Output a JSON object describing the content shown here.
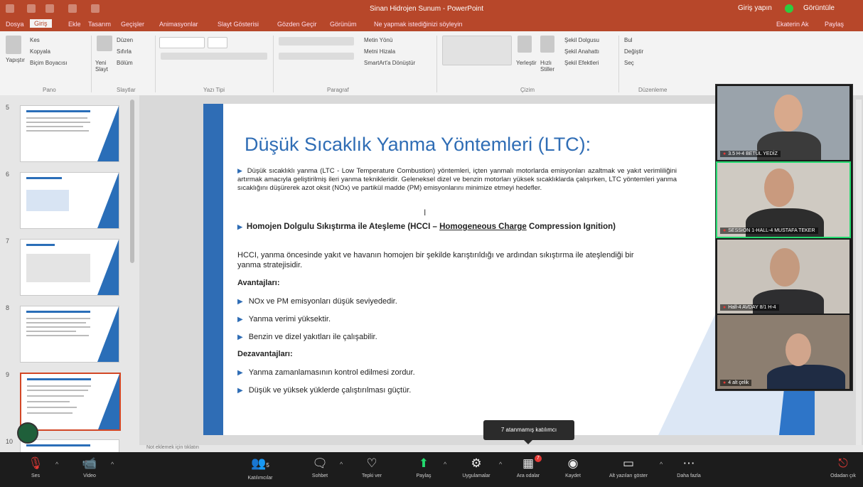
{
  "window": {
    "title": "Sinan Hidrojen Sunum - PowerPoint",
    "signin": "Giriş yapın",
    "display": "Görüntüle"
  },
  "ribbon_tabs": [
    "Dosya",
    "Giriş",
    "Ekle",
    "Tasarım",
    "Geçişler",
    "Animasyonlar",
    "Slayt Gösterisi",
    "Gözden Geçir",
    "Görünüm"
  ],
  "ribbon_search": "Ne yapmak istediğinizi söyleyin",
  "ribbon_right": {
    "share_user": "Ekaterin Ak",
    "share": "Paylaş"
  },
  "ribbon": {
    "clipboard": {
      "paste": "Yapıştır",
      "cut": "Kes",
      "copy": "Kopyala",
      "format": "Biçim Boyacısı",
      "label": "Pano"
    },
    "slides": {
      "new": "Yeni Slayt",
      "layout": "Düzen",
      "reset": "Sıfırla",
      "section": "Bölüm",
      "label": "Slaytlar"
    },
    "font": {
      "label": "Yazı Tipi"
    },
    "paragraph": {
      "direction": "Metin Yönü",
      "align": "Metni Hizala",
      "smartart": "SmartArt'a Dönüştür",
      "label": "Paragraf"
    },
    "drawing": {
      "arrange": "Yerleştir",
      "quick": "Hızlı Stiller",
      "fill": "Şekil Dolgusu",
      "outline": "Şekil Anahattı",
      "effects": "Şekil Efektleri",
      "label": "Çizim"
    },
    "editing": {
      "find": "Bul",
      "replace": "Değiştir",
      "select": "Seç",
      "label": "Düzenleme"
    }
  },
  "thumbnails": [
    {
      "num": "5",
      "selected": false
    },
    {
      "num": "6",
      "selected": false
    },
    {
      "num": "7",
      "selected": false
    },
    {
      "num": "8",
      "selected": false
    },
    {
      "num": "9",
      "selected": true
    },
    {
      "num": "10",
      "selected": false
    }
  ],
  "slide": {
    "title": "Düşük Sıcaklık Yanma Yöntemleri (LTC):",
    "bullet1": "Düşük sıcaklıklı yanma (LTC - Low Temperature Combustion) yöntemleri, içten yanmalı motorlarda emisyonları azaltmak ve yakıt verimliliğini artırmak amacıyla geliştirilmiş ileri yanma teknikleridir. Geleneksel dizel ve benzin motorları yüksek sıcaklıklarda çalışırken, LTC yöntemleri yanma sıcaklığını düşürerek azot oksit (NOx) ve partikül madde (PM) emisyonlarını minimize etmeyi hedefler.",
    "bullet2_a": "Homojen Dolgulu Sıkıştırma ile Ateşleme (HCCI – ",
    "bullet2_u": "Homogeneous Charge",
    "bullet2_b": " Compression Ignition)",
    "para": "HCCI, yanma öncesinde yakıt ve havanın homojen bir şekilde karıştırıldığı ve ardından sıkıştırma ile ateşlendiği bir yanma stratejisidir.",
    "adv_heading": "Avantajları:",
    "advantages": [
      "NOx ve PM emisyonları düşük seviyededir.",
      "Yanma verimi yüksektir.",
      "Benzin ve dizel yakıtları ile çalışabilir."
    ],
    "dis_heading": "Dezavantajları:",
    "disadvantages": [
      "Yanma zamanlamasının kontrol edilmesi zordur.",
      "Düşük ve yüksek yüklerde çalıştırılması güçtür."
    ]
  },
  "notes_hint": "Not eklemek için tıklatın",
  "participants": [
    {
      "name": "3.5 H-4 BETÜL YEDİZ",
      "speaking": false
    },
    {
      "name": "SESSION 1-HALL-4 MUSTAFA TEKER",
      "speaking": true
    },
    {
      "name": "Hall-4 AVDAY 8/1 H-4",
      "speaking": false
    },
    {
      "name": "4 alt çelik",
      "speaking": false
    }
  ],
  "tooltip": "7 atanmamış katılımcı",
  "toolbar": {
    "audio": "Ses",
    "video": "Video",
    "participants": "Katılımcılar",
    "participants_count": "5",
    "chat": "Sohbet",
    "react": "Tepki ver",
    "share": "Paylaş",
    "apps": "Uygulamalar",
    "breakout": "Ara odalar",
    "breakout_badge": "7",
    "record": "Kaydet",
    "captions": "Alt yazıları göster",
    "more": "Daha fazla",
    "leave": "Odadan çık"
  }
}
